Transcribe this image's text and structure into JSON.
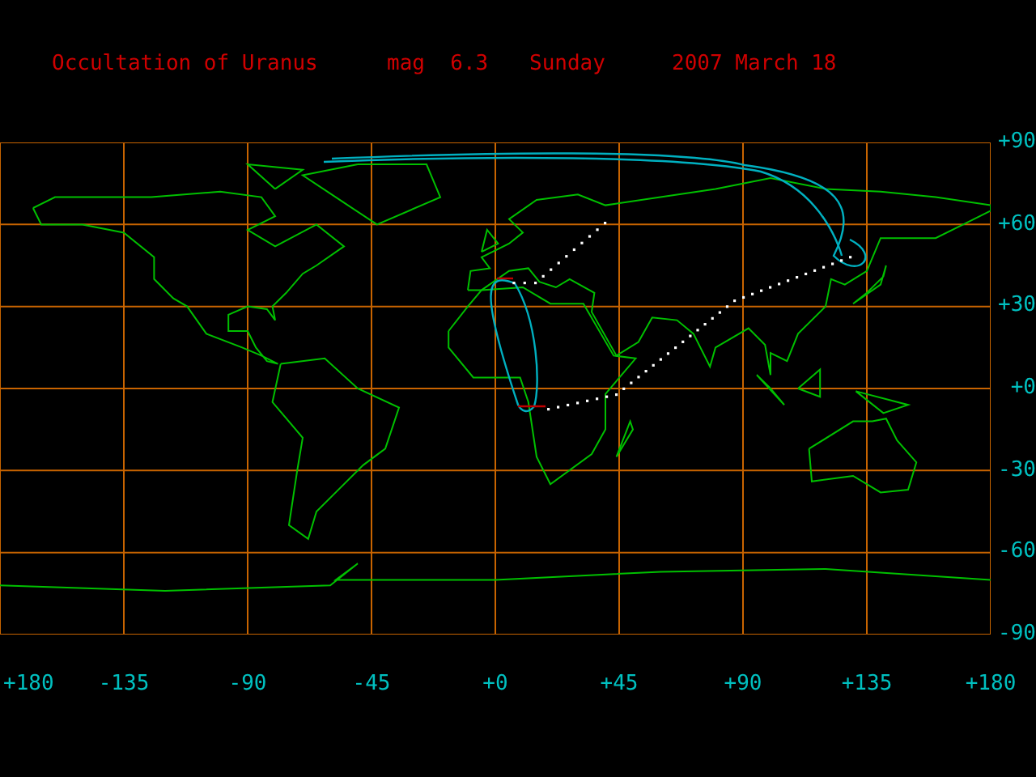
{
  "title": {
    "event": "Occultation of Uranus",
    "magnitude": "mag  6.3",
    "weekday": "Sunday",
    "date": "2007 March 18"
  },
  "map": {
    "lat_labels": [
      "+90",
      "+60",
      "+30",
      "+0",
      "-30",
      "-60",
      "-90"
    ],
    "lon_labels": [
      "+180",
      "-135",
      "-90",
      "-45",
      "+0",
      "+45",
      "+90",
      "+135",
      "+180"
    ]
  }
}
